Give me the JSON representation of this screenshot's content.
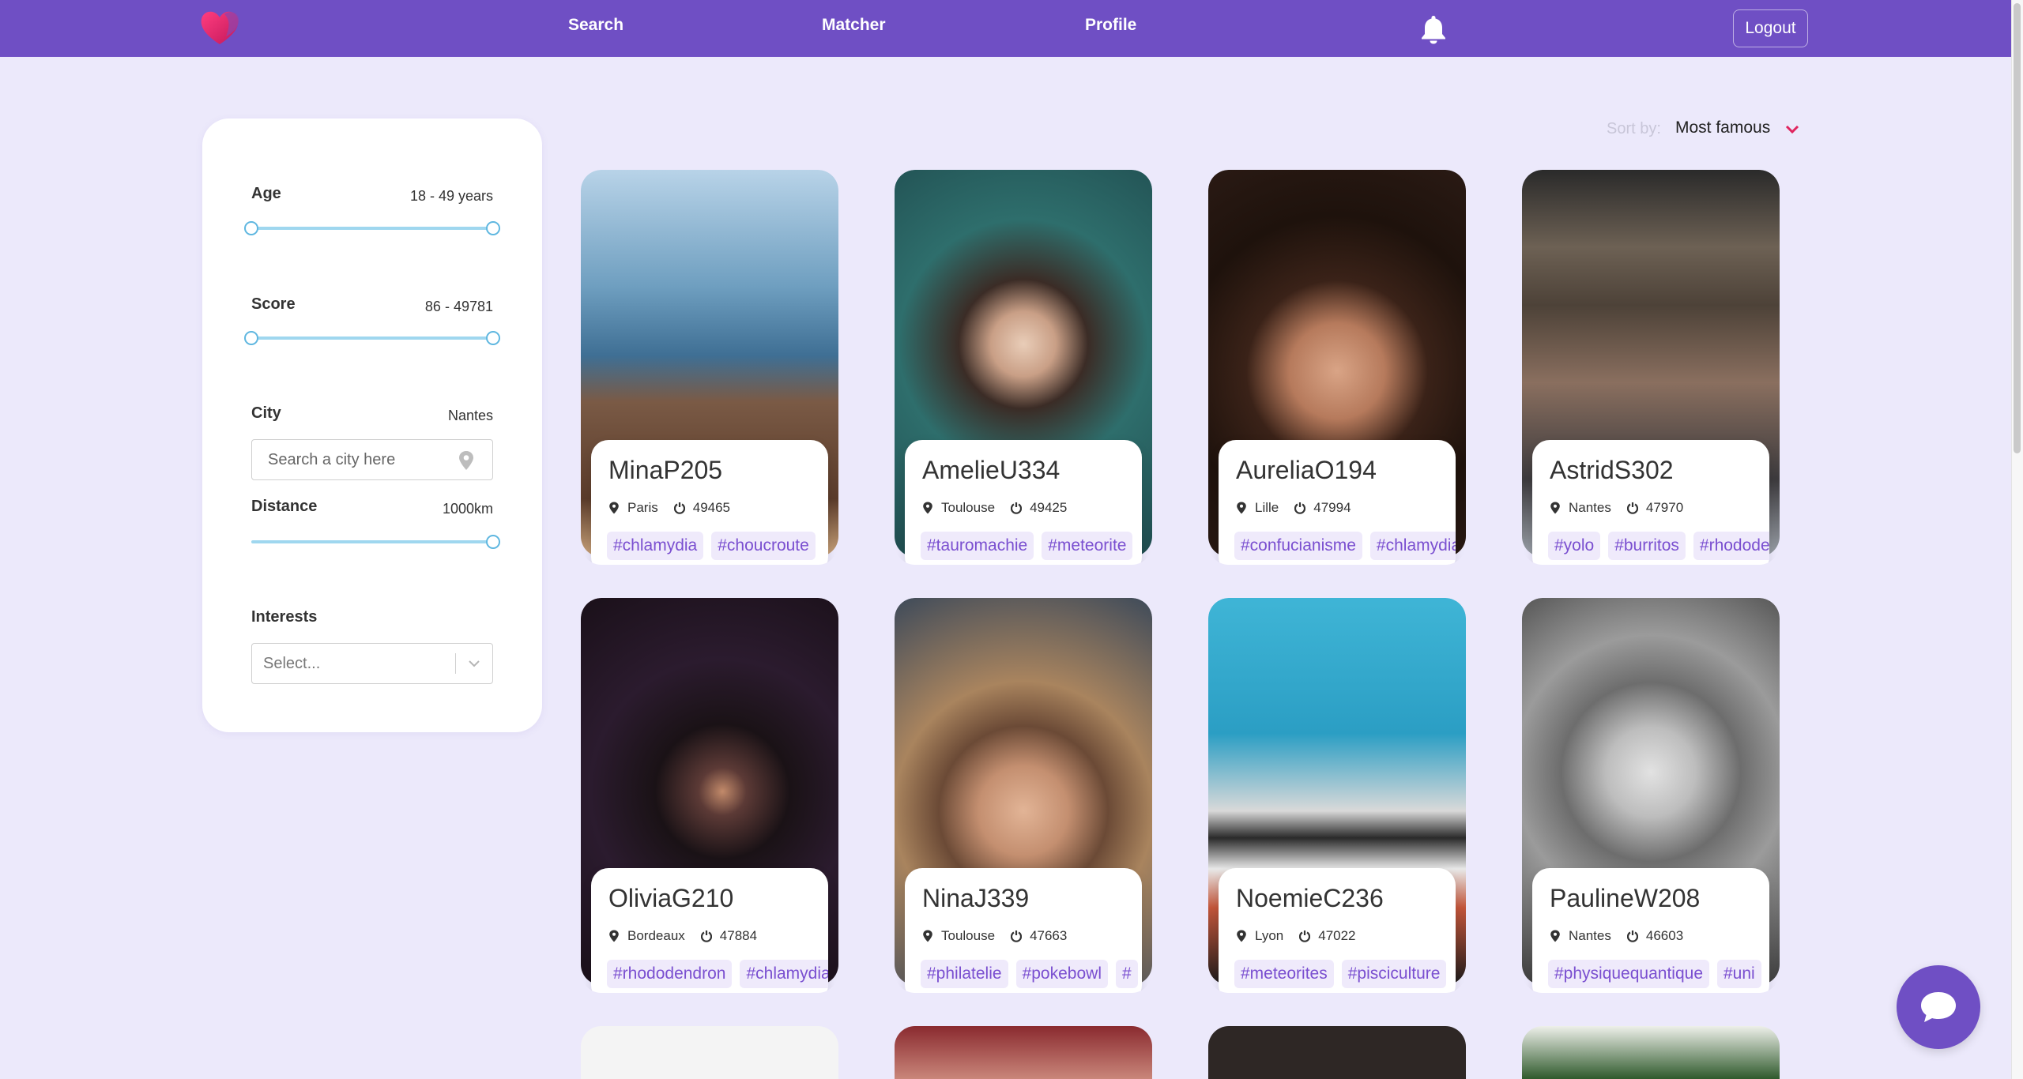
{
  "nav": {
    "search_label": "Search",
    "matcher_label": "Matcher",
    "profile_label": "Profile",
    "logout_label": "Logout",
    "bell_icon": "bell-icon",
    "logo_icon": "heart-logo-icon"
  },
  "filters": {
    "age": {
      "label": "Age",
      "range": "18 - 49 years",
      "min": 18,
      "max": 49
    },
    "score": {
      "label": "Score",
      "range": "86 - 49781",
      "min": 86,
      "max": 49781
    },
    "city": {
      "label": "City",
      "value": "Nantes",
      "placeholder": "Search a city here",
      "icon": "map-pin-icon"
    },
    "distance": {
      "label": "Distance",
      "value": "1000km",
      "level": 1.0
    },
    "interests": {
      "label": "Interests",
      "placeholder": "Select..."
    }
  },
  "sort": {
    "label": "Sort by:",
    "value": "Most famous"
  },
  "profiles": [
    {
      "username": "MinaP205",
      "city": "Paris",
      "score": "49465",
      "tags": [
        "#chlamydia",
        "#choucroute"
      ]
    },
    {
      "username": "AmelieU334",
      "city": "Toulouse",
      "score": "49425",
      "tags": [
        "#tauromachie",
        "#meteorite"
      ]
    },
    {
      "username": "AureliaO194",
      "city": "Lille",
      "score": "47994",
      "tags": [
        "#confucianisme",
        "#chlamydia"
      ]
    },
    {
      "username": "AstridS302",
      "city": "Nantes",
      "score": "47970",
      "tags": [
        "#yolo",
        "#burritos",
        "#rhododendron"
      ]
    },
    {
      "username": "OliviaG210",
      "city": "Bordeaux",
      "score": "47884",
      "tags": [
        "#rhododendron",
        "#chlamydia"
      ]
    },
    {
      "username": "NinaJ339",
      "city": "Toulouse",
      "score": "47663",
      "tags": [
        "#philatelie",
        "#pokebowl",
        "#"
      ]
    },
    {
      "username": "NoemieC236",
      "city": "Lyon",
      "score": "47022",
      "tags": [
        "#meteorites",
        "#pisciculture"
      ]
    },
    {
      "username": "PaulineW208",
      "city": "Nantes",
      "score": "46603",
      "tags": [
        "#physiquequantique",
        "#uni"
      ]
    }
  ],
  "colors": {
    "brand": "#6f4fc4",
    "background": "#ece9fb",
    "tag_text": "#7a4fd0",
    "tag_bg": "#efeafb",
    "slider": "#9fd7ef"
  },
  "chat_icon": "chat-bubble-icon"
}
